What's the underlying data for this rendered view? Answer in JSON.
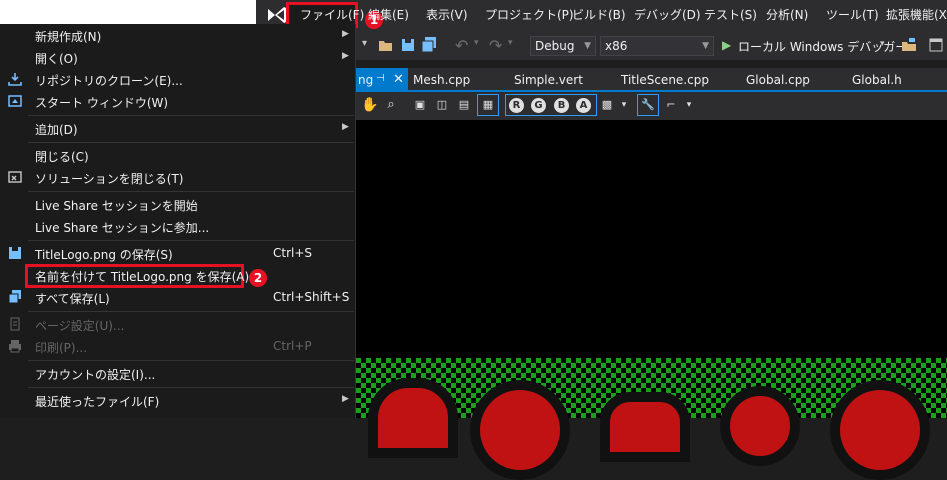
{
  "menubar": {
    "items": [
      "ファイル(F)",
      "編集(E)",
      "表示(V)",
      "プロジェクト(P)",
      "ビルド(B)",
      "デバッグ(D)",
      "テスト(S)",
      "分析(N)",
      "ツール(T)",
      "拡張機能(X)"
    ]
  },
  "annotations": {
    "step1": "1",
    "step2": "2",
    "highlight_color": "#e81123"
  },
  "toolbar": {
    "config": "Debug",
    "platform": "x86",
    "run_label": "ローカル Windows デバッガー"
  },
  "tabs": [
    "ng",
    "Mesh.cpp",
    "Simple.vert",
    "TitleScene.cpp",
    "Global.cpp",
    "Global.h"
  ],
  "image_toolbar": {
    "channels": [
      "R",
      "G",
      "B",
      "A"
    ]
  },
  "file_menu": {
    "new": "新規作成(N)",
    "open": "開く(O)",
    "clone": "リポジトリのクローン(E)...",
    "start_window": "スタート ウィンドウ(W)",
    "add": "追加(D)",
    "close": "閉じる(C)",
    "close_solution": "ソリューションを閉じる(T)",
    "liveshare_start": "Live Share セッションを開始",
    "liveshare_join": "Live Share セッションに参加...",
    "save": "TitleLogo.png の保存(S)",
    "save_shortcut": "Ctrl+S",
    "save_as": "名前を付けて TitleLogo.png を保存(A)...",
    "save_all": "すべて保存(L)",
    "save_all_shortcut": "Ctrl+Shift+S",
    "page_setup": "ページ設定(U)...",
    "print": "印刷(P)...",
    "print_shortcut": "Ctrl+P",
    "account": "アカウントの設定(I)...",
    "recent": "最近使ったファイル(F)"
  },
  "colors": {
    "accent": "#007acc",
    "menu_bg": "#1b1b1c",
    "chrome_bg": "#2d2d30"
  }
}
